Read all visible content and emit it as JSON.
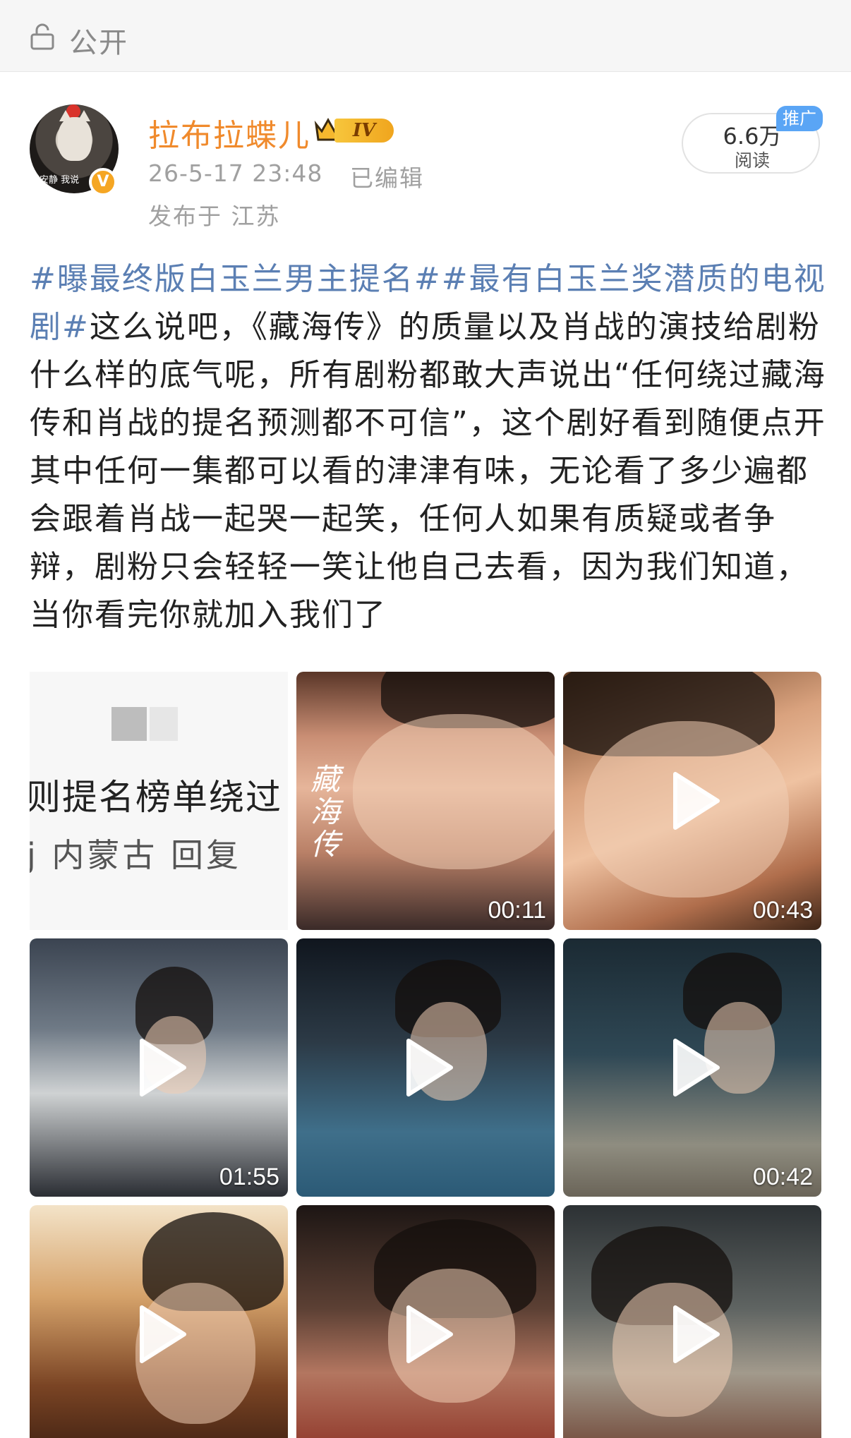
{
  "header": {
    "visibility_label": "公开"
  },
  "author": {
    "name": "拉布拉蝶儿",
    "vip_level": "IV",
    "avatar_caption": "安静 我说",
    "post_time": "26-5-17 23:48",
    "edited_label": "已编辑",
    "location": "发布于 江苏"
  },
  "stats": {
    "read_count": "6.6万",
    "read_label": "阅读",
    "promo_badge": "推广"
  },
  "post": {
    "topic1": "#曝最终版白玉兰男主提名#",
    "topic2": "#最有白玉兰奖潜质的电视剧#",
    "body": "这么说吧，《藏海传》的质量以及肖战的演技给剧粉什么样的底气呢，所有剧粉都敢大声说出“任何绕过藏海传和肖战的提名预测都不可信”，这个剧好看到随便点开其中任何一集都可以看的津津有味，无论看了多少遍都会跟着肖战一起哭一起笑，任何人如果有质疑或者争辩，剧粉只会轻轻一笑让他自己去看，因为我们知道，当你看完你就加入我们了"
  },
  "media": {
    "screenshot_line1": "则提名榜单绕过",
    "screenshot_line2": "j 内蒙古  回复",
    "video_title_overlay": "藏海传",
    "durations": [
      "00:11",
      "00:43",
      "01:55",
      "",
      "00:42",
      "",
      "",
      ""
    ]
  },
  "colors": {
    "username": "#f08a2c",
    "topic_link": "#5b7fb3",
    "promo": "#5aa5f5",
    "vip": "#f0a51e"
  },
  "icons": {
    "visibility": "lock-open-icon",
    "play": "play-icon",
    "verified": "verified-v-icon",
    "vip": "crown-icon"
  }
}
